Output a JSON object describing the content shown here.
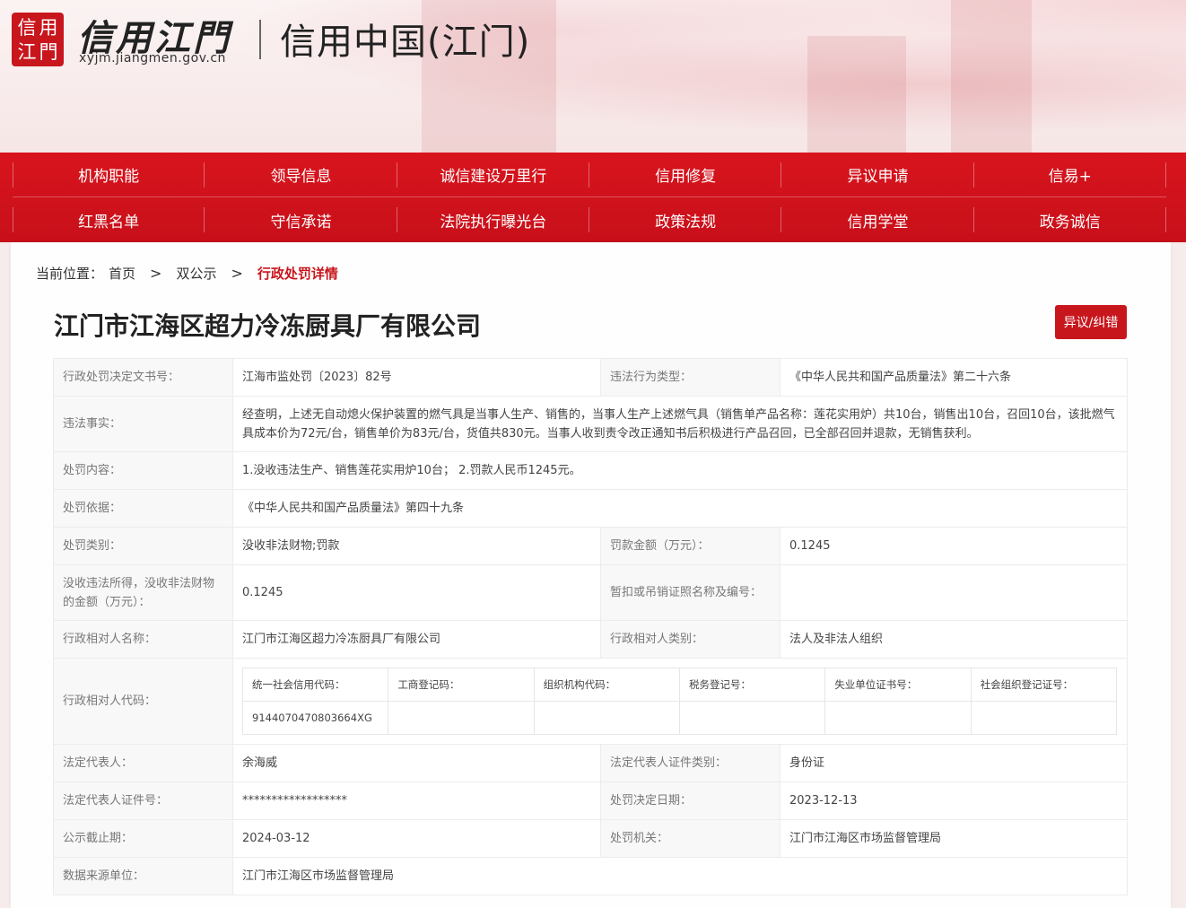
{
  "header": {
    "logo_seal": [
      "信",
      "用",
      "江",
      "門"
    ],
    "logo_title": "信用江門",
    "logo_url": "xyjm.jiangmen.gov.cn",
    "site_title": "信用中国(江门)"
  },
  "nav": {
    "row1": [
      "机构职能",
      "领导信息",
      "诚信建设万里行",
      "信用修复",
      "异议申请",
      "信易+"
    ],
    "row2": [
      "红黑名单",
      "守信承诺",
      "法院执行曝光台",
      "政策法规",
      "信用学堂",
      "政务诚信"
    ]
  },
  "breadcrumb": {
    "label": "当前位置：",
    "items": [
      "首页",
      "双公示"
    ],
    "separator": ">",
    "current": "行政处罚详情"
  },
  "page_title": "江门市江海区超力冷冻厨具厂有限公司",
  "objection_button": "异议/纠错",
  "details": {
    "doc_no_label": "行政处罚决定文书号：",
    "doc_no": "江海市监处罚〔2023〕82号",
    "violation_type_label": "违法行为类型：",
    "violation_type": "《中华人民共和国产品质量法》第二十六条",
    "facts_label": "违法事实：",
    "facts": "经查明，上述无自动熄火保护装置的燃气具是当事人生产、销售的，当事人生产上述燃气具（销售单产品名称：莲花实用炉）共10台，销售出10台，召回10台，该批燃气具成本价为72元/台，销售单价为83元/台，货值共830元。当事人收到责令改正通知书后积极进行产品召回，已全部召回并退款，无销售获利。",
    "content_label": "处罚内容：",
    "content": "1.没收违法生产、销售莲花实用炉10台； 2.罚款人民币1245元。",
    "basis_label": "处罚依据：",
    "basis": "《中华人民共和国产品质量法》第四十九条",
    "category_label": "处罚类别：",
    "category": "没收非法财物;罚款",
    "fine_label": "罚款金额（万元）：",
    "fine": "0.1245",
    "confiscation_label": "没收违法所得，没收非法财物的金额（万元）：",
    "confiscation": "0.1245",
    "license_label": "暂扣或吊销证照名称及编号：",
    "license": "",
    "party_name_label": "行政相对人名称：",
    "party_name": "江门市江海区超力冷冻厨具厂有限公司",
    "party_type_label": "行政相对人类别：",
    "party_type": "法人及非法人组织",
    "party_code_label": "行政相对人代码：",
    "codes": {
      "headers": [
        "统一社会信用代码：",
        "工商登记码：",
        "组织机构代码：",
        "税务登记号：",
        "失业单位证书号：",
        "社会组织登记证号："
      ],
      "values": [
        "9144070470803664XG",
        "",
        "",
        "",
        "",
        ""
      ]
    },
    "legal_rep_label": "法定代表人：",
    "legal_rep": "余海威",
    "legal_id_type_label": "法定代表人证件类别：",
    "legal_id_type": "身份证",
    "legal_id_no_label": "法定代表人证件号：",
    "legal_id_no": "******************",
    "decision_date_label": "处罚决定日期：",
    "decision_date": "2023-12-13",
    "deadline_label": "公示截止期：",
    "deadline": "2024-03-12",
    "authority_label": "处罚机关：",
    "authority": "江门市江海区市场监督管理局",
    "source_label": "数据来源单位：",
    "source": "江门市江海区市场监督管理局"
  }
}
